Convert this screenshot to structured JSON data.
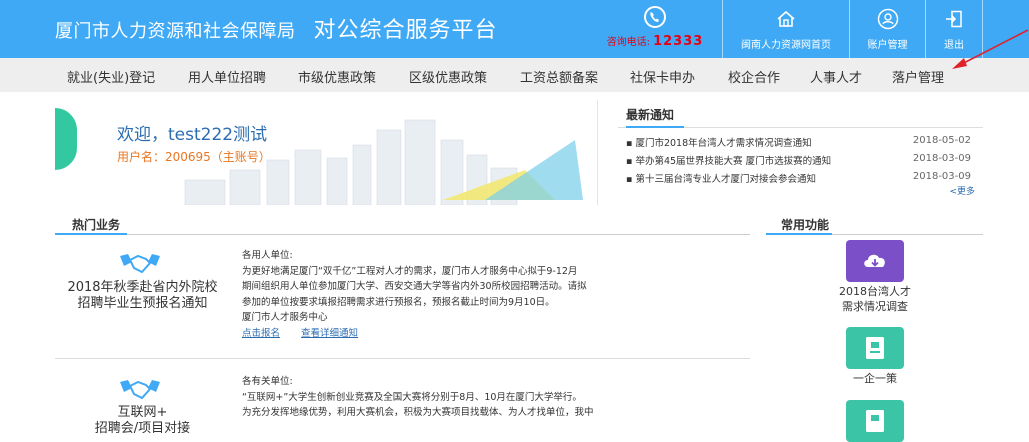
{
  "header": {
    "org_name": "厦门市人力资源和社会保障局",
    "platform_name": "对公综合服务平台",
    "hotline_label": "咨询电话:",
    "hotline_number": "12333",
    "buttons": [
      {
        "label": "闽南人力资源网首页",
        "icon": "home-icon"
      },
      {
        "label": "账户管理",
        "icon": "user-icon"
      },
      {
        "label": "退出",
        "icon": "logout-icon"
      }
    ]
  },
  "nav": {
    "items": [
      "就业(失业)登记",
      "用人单位招聘",
      "市级优惠政策",
      "区级优惠政策",
      "工资总额备案",
      "社保卡申办",
      "校企合作",
      "人事人才",
      "落户管理"
    ]
  },
  "welcome": {
    "greeting": "欢迎，test222测试",
    "username_line": "用户名：200695（主账号）"
  },
  "notices": {
    "title": "最新通知",
    "items": [
      {
        "text": "厦门市2018年台湾人才需求情况调查通知",
        "date": "2018-05-02"
      },
      {
        "text": "举办第45届世界技能大赛 厦门市选拔赛的通知",
        "date": "2018-03-09"
      },
      {
        "text": "第十三届台湾专业人才厦门对接会参会通知",
        "date": "2018-03-09"
      }
    ],
    "more": "<更多"
  },
  "hot": {
    "title": "热门业务",
    "cards": [
      {
        "name_line1": "2018年秋季赴省内外院校",
        "name_line2": "招聘毕业生预报名通知",
        "lines": [
          "各用人单位:",
          "为更好地满足厦门“双千亿”工程对人才的需求，厦门市人才服务中心拟于9-12月",
          "期间组织用人单位参加厦门大学、西安交通大学等省内外30所校园招聘活动。请拟",
          "参加的单位按要求填报招聘需求进行预报名，预报名截止时间为9月10日。",
          "厦门市人才服务中心"
        ],
        "link_signup": "点击报名",
        "link_detail": "查看详细通知"
      },
      {
        "name_line1": "互联网+",
        "name_line2": "招聘会/项目对接",
        "lines": [
          "各有关单位:",
          "“互联网+”大学生创新创业竞赛及全国大赛将分别于8月、10月在厦门大学举行。",
          "为充分发挥地缘优势，利用大赛机会，积极为大赛项目找载体、为人才找单位，我中"
        ]
      }
    ]
  },
  "common": {
    "title": "常用功能",
    "items": [
      {
        "line1": "2018台湾人才",
        "line2": "需求情况调查",
        "color": "#7b4fc8",
        "icon": "cloud-download-icon"
      },
      {
        "line1": "一企一策",
        "line2": "",
        "color": "#3cc4a6",
        "icon": "document-icon"
      },
      {
        "line1": "",
        "line2": "",
        "color": "#3cc4a6",
        "icon": "document-icon"
      }
    ]
  },
  "colors": {
    "header_bg": "#3fa9f5",
    "nav_bg": "#eeeeee",
    "hotline_red": "#e60012",
    "link_blue": "#2b6cb0",
    "username_orange": "#e87722",
    "annotation_arrow": "#e0222b"
  }
}
